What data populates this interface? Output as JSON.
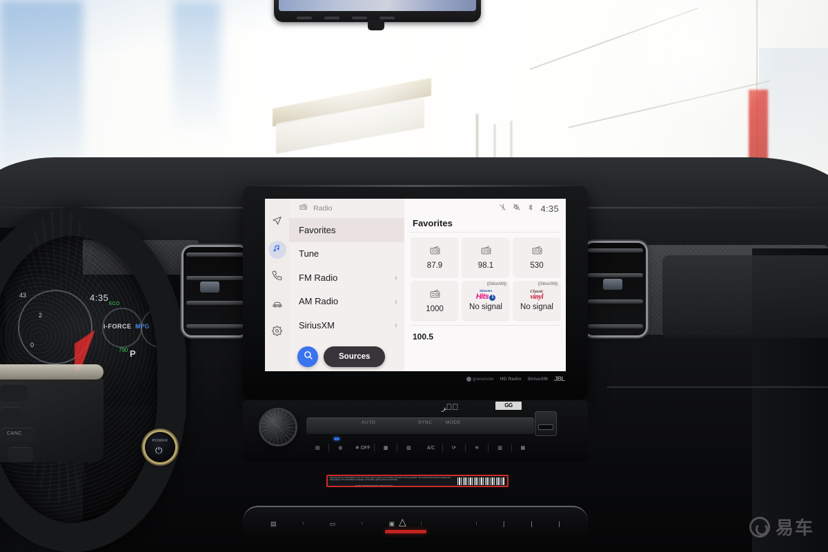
{
  "scene": {
    "description": "Toyota Tundra interior dashboard with 14-inch infotainment touchscreen showing Radio Favorites"
  },
  "hmi": {
    "rail": [
      {
        "name": "navigation",
        "icon": "navigation-arrow-icon",
        "active": false
      },
      {
        "name": "media",
        "icon": "music-note-icon",
        "active": true
      },
      {
        "name": "phone",
        "icon": "phone-icon",
        "active": false
      },
      {
        "name": "vehicle",
        "icon": "car-icon",
        "active": false
      },
      {
        "name": "settings",
        "icon": "gear-icon",
        "active": false
      }
    ],
    "header": {
      "source_icon": "radio-icon",
      "source_label": "Radio"
    },
    "status": {
      "mic_icon": "mic-muted-icon",
      "sound_icon": "sound-muted-icon",
      "bluetooth_icon": "bluetooth-icon",
      "time": "4:35"
    },
    "menu": {
      "items": [
        {
          "label": "Favorites",
          "selected": true,
          "chevron": ""
        },
        {
          "label": "Tune",
          "selected": false,
          "chevron": ""
        },
        {
          "label": "FM Radio",
          "selected": false,
          "chevron": "›"
        },
        {
          "label": "AM Radio",
          "selected": false,
          "chevron": "›"
        },
        {
          "label": "SiriusXM",
          "selected": false,
          "chevron": "›"
        }
      ],
      "search_label": "Search",
      "sources_label": "Sources"
    },
    "favorites": {
      "title": "Favorites",
      "tiles": [
        {
          "label": "87.9",
          "icon": "radio-icon",
          "badge": ""
        },
        {
          "label": "98.1",
          "icon": "radio-icon",
          "badge": ""
        },
        {
          "label": "530",
          "icon": "radio-icon",
          "badge": ""
        },
        {
          "label": "1000",
          "icon": "radio-icon",
          "badge": ""
        },
        {
          "label": "No signal",
          "icon": "siriusxm-hits1-logo",
          "badge": "((SiriusXM))",
          "logo_top": "SiriusXm",
          "logo_main": "Hits",
          "logo_num": "1"
        },
        {
          "label": "No signal",
          "icon": "siriusxm-classic-vinyl-logo",
          "badge": "((SiriusXM))",
          "logo_top": "Classic",
          "logo_main": "vinyl"
        }
      ],
      "next_item": "100.5"
    },
    "colors": {
      "accent_blue": "#3a73f0",
      "sources_dark": "#39343a",
      "screen_bg": "#faf8f8",
      "menu_bg": "#f3efee",
      "selected_row": "#e9e2e0"
    }
  },
  "bezel_brands": [
    {
      "label": "gracenote"
    },
    {
      "label": "HD Radio"
    },
    {
      "label": "SiriusXM"
    },
    {
      "label": "JBL"
    }
  ],
  "cluster": {
    "time": "4:35",
    "speed_tick": "43",
    "rpm_2": "2",
    "rpm_0": "0",
    "force_badge": "i-FORCE",
    "mpg_badge": "MPG",
    "gear": "P",
    "eco": "ECO",
    "trip": "790"
  },
  "climate": {
    "labels": [
      "AUTO",
      "SYNC",
      "MODE"
    ],
    "buttons": [
      "❄ OFF",
      "A/C"
    ],
    "gg_badge": "GG"
  },
  "power_button": {
    "label": "POWER",
    "icon": "power-icon"
  },
  "sticker": {
    "line1": "Monitored only by transportation to the unit.  There may be reasons your location information is being recorded. This vehicle and its internal research and data analysis. Not responsible for damages. For durable, please persons at full button.",
    "underline": "TO BE MONITORED BY OWNER ONLY"
  },
  "watermark": {
    "text": "易车",
    "icon": "yiche-logo"
  }
}
